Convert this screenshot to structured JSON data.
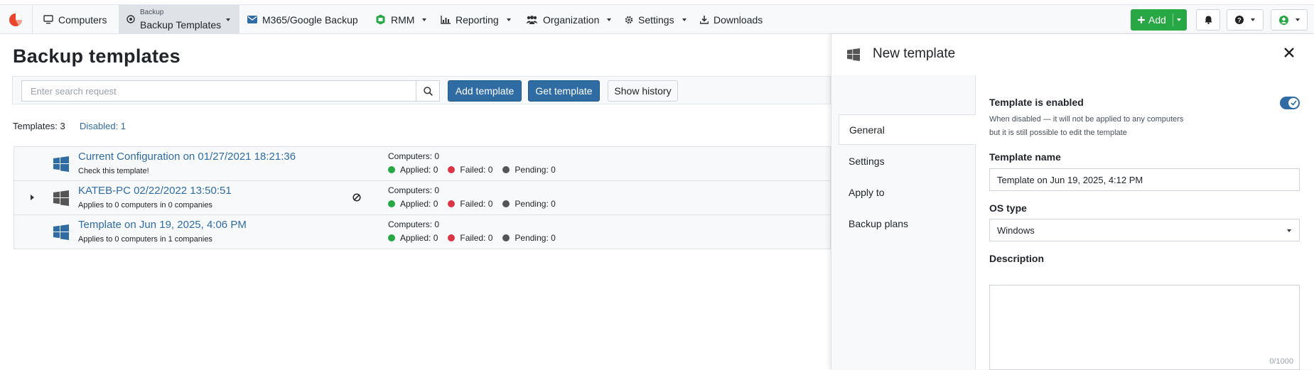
{
  "nav": {
    "computers": "Computers",
    "backup_small": "Backup",
    "backup_big": "Backup Templates",
    "m365": "M365/Google Backup",
    "rmm": "RMM",
    "reporting": "Reporting",
    "organization": "Organization",
    "settings": "Settings",
    "downloads": "Downloads",
    "add": "Add"
  },
  "page": {
    "title": "Backup templates",
    "search_placeholder": "Enter search request",
    "add_template": "Add template",
    "get_template": "Get template",
    "show_history": "Show history",
    "templates_count": "Templates: 3",
    "disabled_count": "Disabled: 1"
  },
  "templates": [
    {
      "name": "Current Configuration on 01/27/2021 18:21:36",
      "sub": "Check this template!",
      "computers": "Computers: 0",
      "applied": "Applied: 0",
      "failed": "Failed: 0",
      "pending": "Pending: 0"
    },
    {
      "name": "KATEB-PC 02/22/2022 13:50:51",
      "sub": "Applies to 0 computers in 0 companies",
      "computers": "Computers: 0",
      "applied": "Applied: 0",
      "failed": "Failed: 0",
      "pending": "Pending: 0"
    },
    {
      "name": "Template on Jun 19, 2025, 4:06 PM",
      "sub": "Applies to 0 computers in 1 companies",
      "computers": "Computers: 0",
      "applied": "Applied: 0",
      "failed": "Failed: 0",
      "pending": "Pending: 0"
    }
  ],
  "panel": {
    "title": "New template",
    "tabs": [
      "General",
      "Settings",
      "Apply to",
      "Backup plans"
    ],
    "enabled_label": "Template is enabled",
    "enabled_value": true,
    "enabled_hint_1": "When disabled — it will not be applied to any computers",
    "enabled_hint_2": "but it is still possible to edit the template",
    "name_label": "Template name",
    "name_value": "Template on Jun 19, 2025, 4:12 PM",
    "os_label": "OS type",
    "os_value": "Windows",
    "description_label": "Description",
    "description_count": "0/1000"
  },
  "colors": {
    "primary": "#2f6ca3",
    "success": "#28a745",
    "applied": "#28a745",
    "failed": "#dc3545",
    "pending": "#555555"
  }
}
